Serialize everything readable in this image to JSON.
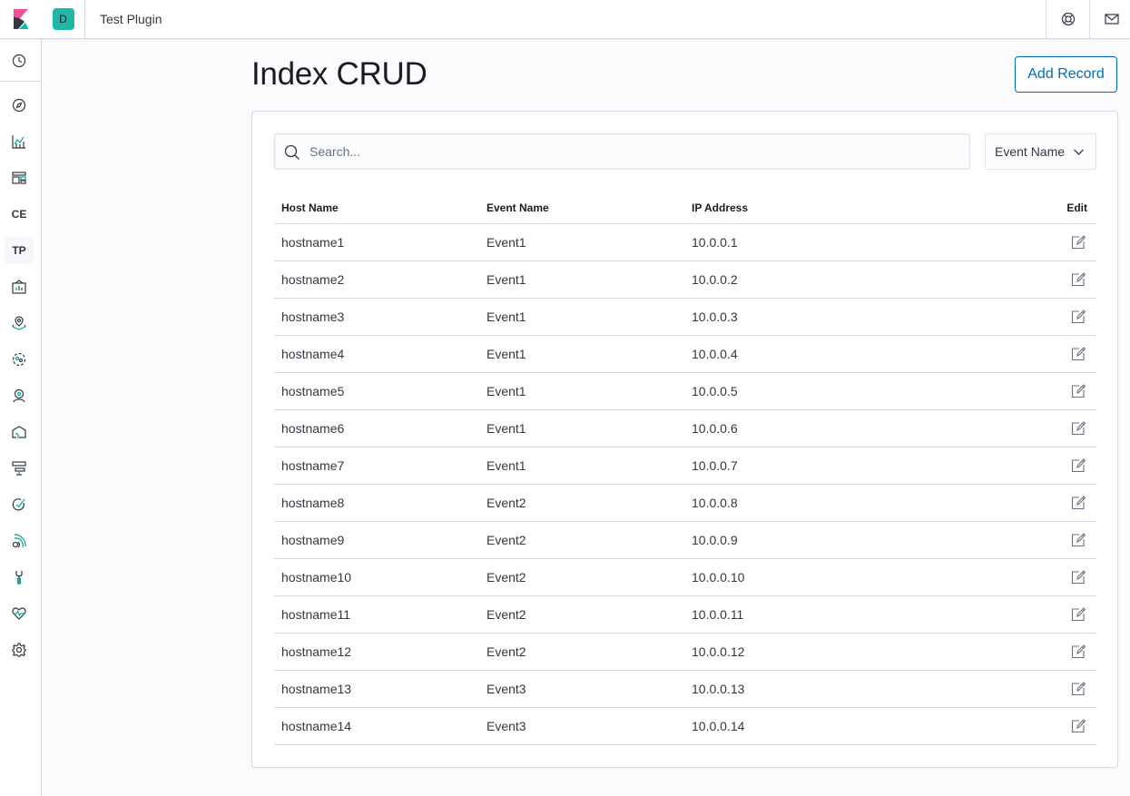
{
  "header": {
    "space_initial": "D",
    "app_title": "Test Plugin"
  },
  "sidenav": {
    "items": [
      {
        "name": "recently-viewed",
        "label": "",
        "icon": "clock-icon"
      },
      {
        "name": "discover",
        "label": "",
        "icon": "compass-icon"
      },
      {
        "name": "visualize",
        "label": "",
        "icon": "chart-icon"
      },
      {
        "name": "dashboard",
        "label": "",
        "icon": "dashboard-icon"
      },
      {
        "name": "ce",
        "label": "CE",
        "icon": ""
      },
      {
        "name": "tp",
        "label": "TP",
        "icon": ""
      },
      {
        "name": "canvas",
        "label": "",
        "icon": "canvas-icon"
      },
      {
        "name": "maps",
        "label": "",
        "icon": "maps-icon"
      },
      {
        "name": "ml",
        "label": "",
        "icon": "ml-icon"
      },
      {
        "name": "graph",
        "label": "",
        "icon": "graph-icon"
      },
      {
        "name": "infra",
        "label": "",
        "icon": "infra-icon"
      },
      {
        "name": "logs",
        "label": "",
        "icon": "logs-icon"
      },
      {
        "name": "apm",
        "label": "",
        "icon": "apm-icon"
      },
      {
        "name": "uptime",
        "label": "",
        "icon": "uptime-icon"
      },
      {
        "name": "dev-tools",
        "label": "",
        "icon": "wrench-icon"
      },
      {
        "name": "monitoring",
        "label": "",
        "icon": "heartbeat-icon"
      },
      {
        "name": "management",
        "label": "",
        "icon": "gear-icon"
      }
    ]
  },
  "page": {
    "title": "Index CRUD",
    "add_button": "Add Record"
  },
  "search": {
    "placeholder": "Search..."
  },
  "filter": {
    "label": "Event Name"
  },
  "table": {
    "columns": [
      "Host Name",
      "Event Name",
      "IP Address",
      "Edit"
    ],
    "rows": [
      [
        "hostname1",
        "Event1",
        "10.0.0.1"
      ],
      [
        "hostname2",
        "Event1",
        "10.0.0.2"
      ],
      [
        "hostname3",
        "Event1",
        "10.0.0.3"
      ],
      [
        "hostname4",
        "Event1",
        "10.0.0.4"
      ],
      [
        "hostname5",
        "Event1",
        "10.0.0.5"
      ],
      [
        "hostname6",
        "Event1",
        "10.0.0.6"
      ],
      [
        "hostname7",
        "Event1",
        "10.0.0.7"
      ],
      [
        "hostname8",
        "Event2",
        "10.0.0.8"
      ],
      [
        "hostname9",
        "Event2",
        "10.0.0.9"
      ],
      [
        "hostname10",
        "Event2",
        "10.0.0.10"
      ],
      [
        "hostname11",
        "Event2",
        "10.0.0.11"
      ],
      [
        "hostname12",
        "Event2",
        "10.0.0.12"
      ],
      [
        "hostname13",
        "Event3",
        "10.0.0.13"
      ],
      [
        "hostname14",
        "Event3",
        "10.0.0.14"
      ]
    ]
  },
  "colors": {
    "accent": "#006bb4",
    "space_avatar": "#1fb8a7",
    "border": "#d3dae6"
  }
}
